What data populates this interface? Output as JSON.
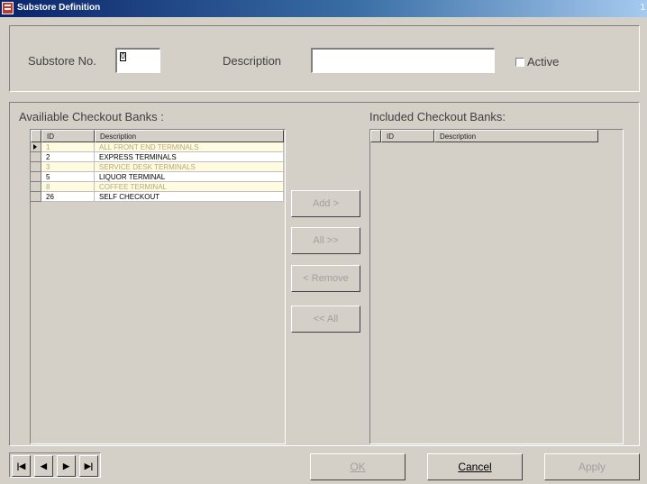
{
  "window": {
    "title": "Substore Definition",
    "title_right": "1"
  },
  "header": {
    "substore_no_label": "Substore No.",
    "substore_no_value": "0",
    "description_label": "Description",
    "description_value": "",
    "active_label": "Active",
    "active_checked": false
  },
  "available": {
    "heading": "Availiable Checkout Banks :",
    "columns": [
      "ID",
      "Description"
    ],
    "rows": [
      {
        "id": "1",
        "description": "ALL FRONT END TERMINALS",
        "style": "yellow",
        "selected": true
      },
      {
        "id": "2",
        "description": "EXPRESS TERMINALS",
        "style": "white",
        "selected": false
      },
      {
        "id": "3",
        "description": "SERVICE DESK TERMINALS",
        "style": "yellow",
        "selected": false
      },
      {
        "id": "5",
        "description": "LIQUOR TERMINAL",
        "style": "white",
        "selected": false
      },
      {
        "id": "8",
        "description": "COFFEE TERMINAL",
        "style": "yellow",
        "selected": false
      },
      {
        "id": "26",
        "description": "SELF CHECKOUT",
        "style": "white",
        "selected": false
      }
    ]
  },
  "included": {
    "heading": "Included Checkout Banks:",
    "columns": [
      "ID",
      "Description"
    ]
  },
  "move_buttons": {
    "add_label": "Add >",
    "add_all_label": "All >>",
    "remove_label": "< Remove",
    "remove_all_label": "<< All"
  },
  "navigator": {
    "first": "|◀",
    "prev": "◀",
    "next": "▶",
    "last": "▶|"
  },
  "footer": {
    "ok_label": "OK",
    "cancel_label": "Cancel",
    "apply_label": "Apply"
  },
  "colors": {
    "window_bg": "#d4d0c8",
    "titlebar_start": "#0a246a",
    "row_highlight": "#fffbe0"
  }
}
